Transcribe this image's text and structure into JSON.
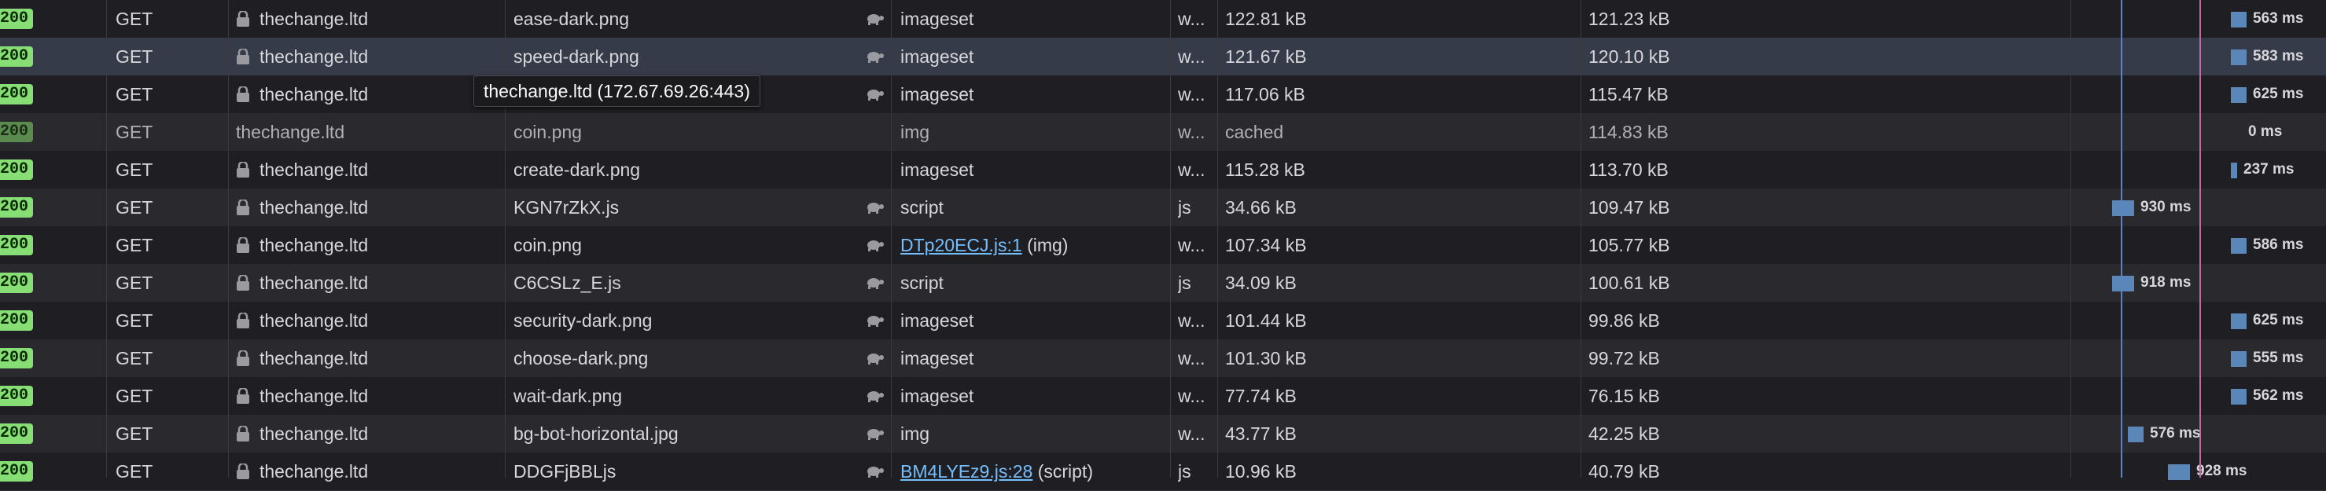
{
  "tooltip": "thechange.ltd (172.67.69.26:443)",
  "colors": {
    "status_ok": "#86de74",
    "waterfall_bar": "#5a86b8",
    "blue_marker": "#5b84c4",
    "pink_marker": "#c06aa6",
    "link": "#75bfff"
  },
  "rows": [
    {
      "status": "200",
      "method": "GET",
      "domain": "thechange.ltd",
      "secure": true,
      "file": "ease-dark.png",
      "throttled": true,
      "initiator": "imageset",
      "initiator_link": "",
      "type": "w...",
      "transferred": "122.81 kB",
      "size": "121.23 kB",
      "time": "563 ms",
      "cached": false
    },
    {
      "status": "200",
      "method": "GET",
      "domain": "thechange.ltd",
      "secure": true,
      "file": "speed-dark.png",
      "throttled": true,
      "initiator": "imageset",
      "initiator_link": "",
      "type": "w...",
      "transferred": "121.67 kB",
      "size": "120.10 kB",
      "time": "583 ms",
      "cached": false
    },
    {
      "status": "200",
      "method": "GET",
      "domain": "thechange.ltd",
      "secure": true,
      "file": "",
      "throttled": true,
      "initiator": "imageset",
      "initiator_link": "",
      "type": "w...",
      "transferred": "117.06 kB",
      "size": "115.47 kB",
      "time": "625 ms",
      "cached": false
    },
    {
      "status": "200",
      "method": "GET",
      "domain": "thechange.ltd",
      "secure": false,
      "file": "coin.png",
      "throttled": false,
      "initiator": "img",
      "initiator_link": "",
      "type": "w...",
      "transferred": "cached",
      "size": "114.83 kB",
      "time": "0 ms",
      "cached": true
    },
    {
      "status": "200",
      "method": "GET",
      "domain": "thechange.ltd",
      "secure": true,
      "file": "create-dark.png",
      "throttled": false,
      "initiator": "imageset",
      "initiator_link": "",
      "type": "w...",
      "transferred": "115.28 kB",
      "size": "113.70 kB",
      "time": "237 ms",
      "cached": false
    },
    {
      "status": "200",
      "method": "GET",
      "domain": "thechange.ltd",
      "secure": true,
      "file": "KGN7rZkX.js",
      "throttled": true,
      "initiator": "script",
      "initiator_link": "",
      "type": "js",
      "transferred": "34.66 kB",
      "size": "109.47 kB",
      "time": "930 ms",
      "cached": false
    },
    {
      "status": "200",
      "method": "GET",
      "domain": "thechange.ltd",
      "secure": true,
      "file": "coin.png",
      "throttled": true,
      "initiator": "(img)",
      "initiator_link": "DTp20ECJ.js:1",
      "type": "w...",
      "transferred": "107.34 kB",
      "size": "105.77 kB",
      "time": "586 ms",
      "cached": false
    },
    {
      "status": "200",
      "method": "GET",
      "domain": "thechange.ltd",
      "secure": true,
      "file": "C6CSLz_E.js",
      "throttled": true,
      "initiator": "script",
      "initiator_link": "",
      "type": "js",
      "transferred": "34.09 kB",
      "size": "100.61 kB",
      "time": "918 ms",
      "cached": false
    },
    {
      "status": "200",
      "method": "GET",
      "domain": "thechange.ltd",
      "secure": true,
      "file": "security-dark.png",
      "throttled": true,
      "initiator": "imageset",
      "initiator_link": "",
      "type": "w...",
      "transferred": "101.44 kB",
      "size": "99.86 kB",
      "time": "625 ms",
      "cached": false
    },
    {
      "status": "200",
      "method": "GET",
      "domain": "thechange.ltd",
      "secure": true,
      "file": "choose-dark.png",
      "throttled": true,
      "initiator": "imageset",
      "initiator_link": "",
      "type": "w...",
      "transferred": "101.30 kB",
      "size": "99.72 kB",
      "time": "555 ms",
      "cached": false
    },
    {
      "status": "200",
      "method": "GET",
      "domain": "thechange.ltd",
      "secure": true,
      "file": "wait-dark.png",
      "throttled": true,
      "initiator": "imageset",
      "initiator_link": "",
      "type": "w...",
      "transferred": "77.74 kB",
      "size": "76.15 kB",
      "time": "562 ms",
      "cached": false
    },
    {
      "status": "200",
      "method": "GET",
      "domain": "thechange.ltd",
      "secure": true,
      "file": "bg-bot-horizontal.jpg",
      "throttled": true,
      "initiator": "img",
      "initiator_link": "",
      "type": "w...",
      "transferred": "43.77 kB",
      "size": "42.25 kB",
      "time": "576 ms",
      "cached": false
    },
    {
      "status": "200",
      "method": "GET",
      "domain": "thechange.ltd",
      "secure": true,
      "file": "DDGFjBBLjs",
      "throttled": true,
      "initiator": "(script)",
      "initiator_link": "BM4LYEz9.js:28",
      "type": "js",
      "transferred": "10.96 kB",
      "size": "40.79 kB",
      "time": "928 ms",
      "cached": false
    }
  ]
}
